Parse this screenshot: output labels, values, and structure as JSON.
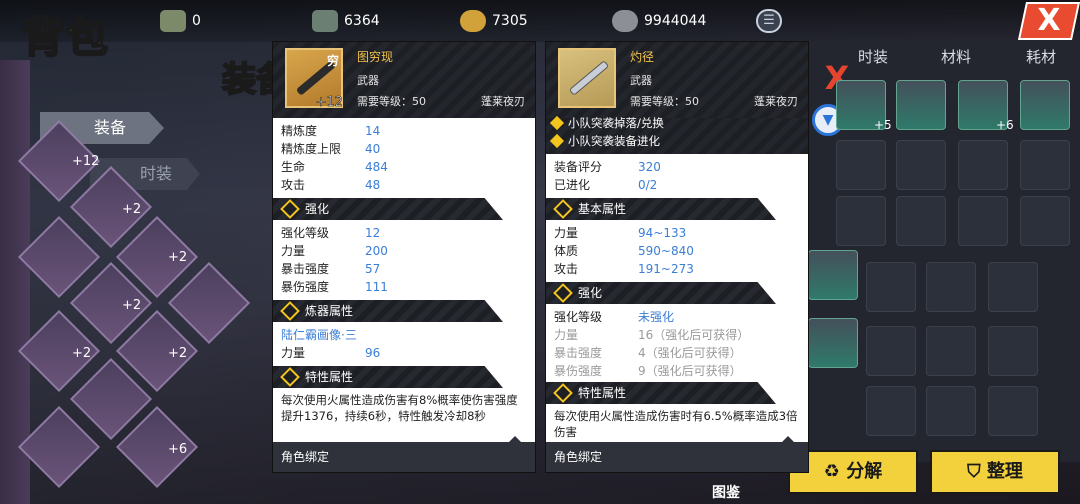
{
  "top_bar": {
    "resources": [
      {
        "icon": "banknote-icon",
        "value": "0"
      },
      {
        "icon": "cash-stack-icon",
        "value": "6364"
      },
      {
        "icon": "gold-coin-icon",
        "value": "7305"
      },
      {
        "icon": "silver-coin-icon",
        "value": "9944044"
      }
    ],
    "close_label": "X",
    "menu_glyph": "☰"
  },
  "page": {
    "bag_title": "背包",
    "equip_heading": "装备",
    "tabs": [
      "装备",
      "时装"
    ],
    "catalog_label": "图鉴"
  },
  "left_grid": {
    "plus_labels": [
      "+12",
      "+2",
      "+2",
      "+2",
      "+2",
      "+2",
      "+6"
    ]
  },
  "right_panel": {
    "tabs": [
      "时装",
      "材料",
      "耗材"
    ],
    "close_label": "X",
    "slot_plus": [
      "+5",
      "+6"
    ],
    "buttons": {
      "decompose": "分解",
      "sort": "整理"
    }
  },
  "card_left": {
    "name": "图穷现",
    "badge": "穷",
    "enhance": "+12",
    "type": "武器",
    "level": "需要等级：50",
    "source": "蓬莱夜刃",
    "stats": [
      {
        "label": "精炼度",
        "value": "14"
      },
      {
        "label": "精炼度上限",
        "value": "40"
      },
      {
        "label": "生命",
        "value": "484"
      },
      {
        "label": "攻击",
        "value": "48"
      }
    ],
    "sections": {
      "enhance": "强化",
      "refine": "炼器属性",
      "special": "特性属性"
    },
    "enhance_stats": [
      {
        "label": "强化等级",
        "value": "12"
      },
      {
        "label": "力量",
        "value": "200"
      },
      {
        "label": "暴击强度",
        "value": "57"
      },
      {
        "label": "暴伤强度",
        "value": "111"
      }
    ],
    "refine_name": "陆仁霸画像·三",
    "refine_stats": [
      {
        "label": "力量",
        "value": "96"
      }
    ],
    "special_text": "每次使用火属性造成伤害有8%概率使伤害强度提升1376，持续6秒，特性触发冷却8秒",
    "footer": "角色绑定"
  },
  "card_right": {
    "name": "灼径",
    "type": "武器",
    "level": "需要等级：50",
    "source": "蓬莱夜刃",
    "team_lines": [
      "小队突袭掉落/兑换",
      "小队突袭装备进化"
    ],
    "stats": [
      {
        "label": "装备评分",
        "value": "320"
      },
      {
        "label": "已进化",
        "value": "0/2"
      }
    ],
    "sections": {
      "base": "基本属性",
      "enhance": "强化",
      "special": "特性属性"
    },
    "base_stats": [
      {
        "label": "力量",
        "value": "94~133"
      },
      {
        "label": "体质",
        "value": "590~840"
      },
      {
        "label": "攻击",
        "value": "191~273"
      }
    ],
    "enhance_stats": [
      {
        "label": "强化等级",
        "value": "未强化",
        "grey": false
      },
      {
        "label": "力量",
        "value": "16（强化后可获得）",
        "grey": true
      },
      {
        "label": "暴击强度",
        "value": "4（强化后可获得）",
        "grey": true
      },
      {
        "label": "暴伤强度",
        "value": "9（强化后可获得）",
        "grey": true
      }
    ],
    "special_text": "每次使用火属性造成伤害时有6.5%概率造成3倍伤害",
    "footer": "角色绑定"
  }
}
